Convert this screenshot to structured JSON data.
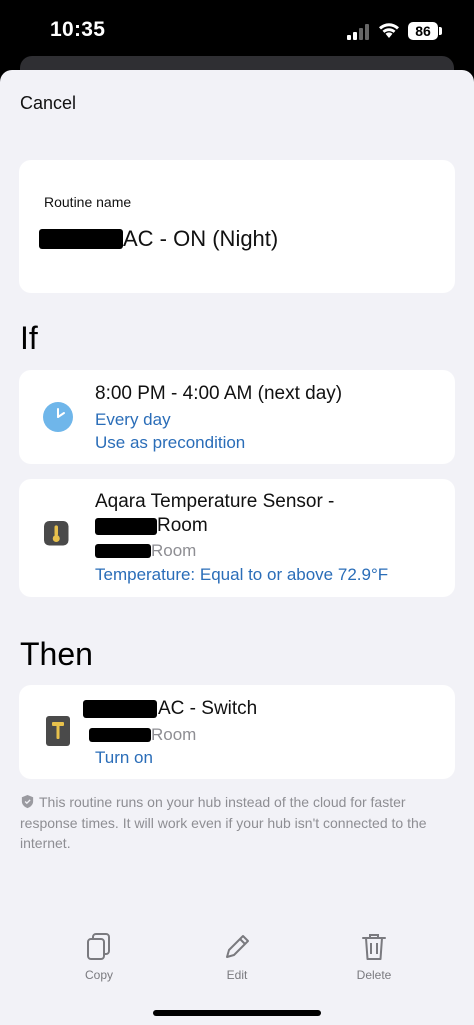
{
  "status_bar": {
    "time": "10:35",
    "battery": "86"
  },
  "header": {
    "cancel_label": "Cancel"
  },
  "routine": {
    "name_label": "Routine name",
    "name_value": "AC - ON (Night)"
  },
  "sections": {
    "if_title": "If",
    "then_title": "Then"
  },
  "conditions": [
    {
      "icon": "clock-icon",
      "title": "8:00 PM - 4:00 AM (next day)",
      "lines": [
        "Every day",
        "Use as precondition"
      ]
    },
    {
      "icon": "thermometer-icon",
      "title": "Aqara Temperature Sensor -",
      "title2": "Room",
      "room": "Room",
      "detail": "Temperature: Equal to or above 72.9°F"
    }
  ],
  "actions": [
    {
      "icon": "switch-icon",
      "title": "AC - Switch",
      "room": "Room",
      "detail": "Turn on"
    }
  ],
  "footnote": "This routine runs on your hub instead of the cloud for faster response times. It will work even if your hub isn't connected to the internet.",
  "toolbar": {
    "copy": "Copy",
    "edit": "Edit",
    "delete": "Delete"
  },
  "colors": {
    "accent_blue": "#2a6db8",
    "background": "#f2f2f7",
    "clock_blue": "#6fb6ea",
    "device_icon_bg": "#4a4a4a",
    "device_icon_accent": "#e8c14c"
  }
}
